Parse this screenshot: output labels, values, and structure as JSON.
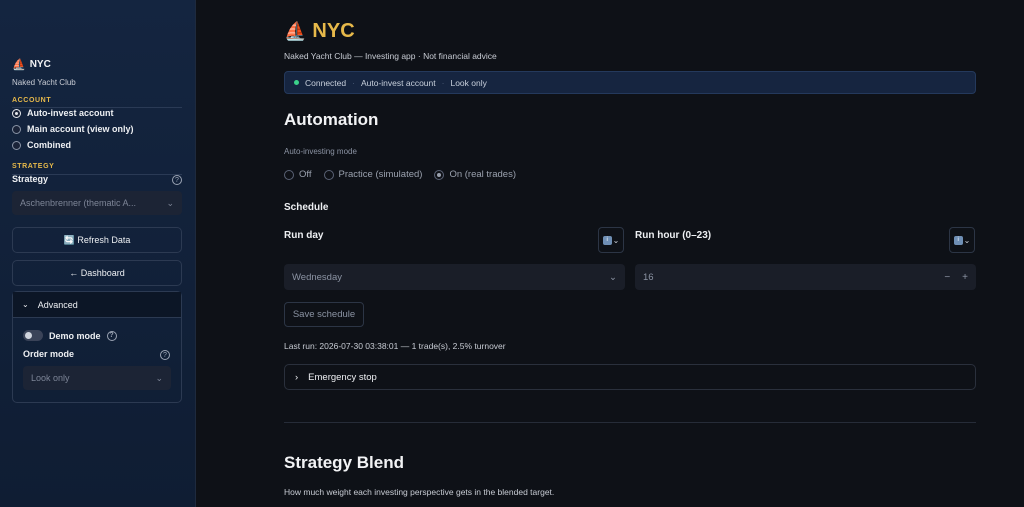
{
  "sidebar": {
    "brand_icon": "⛵",
    "brand": "NYC",
    "club": "Naked Yacht Club",
    "account_label": "ACCOUNT",
    "accounts": [
      {
        "label": "Auto-invest account",
        "selected": true
      },
      {
        "label": "Main account (view only)",
        "selected": false
      },
      {
        "label": "Combined",
        "selected": false
      }
    ],
    "strategy_section": "STRATEGY",
    "strategy_label": "Strategy",
    "strategy_value": "Aschenbrenner (thematic A...",
    "refresh_label": "🔄 Refresh Data",
    "dashboard_label": "← Dashboard",
    "advanced": {
      "title": "Advanced",
      "demo_label": "Demo mode",
      "order_label": "Order mode",
      "order_value": "Look only"
    }
  },
  "main": {
    "brand_icon": "⛵",
    "title": "NYC",
    "subtitle": "Naked Yacht Club — Investing app · Not financial advice",
    "status": {
      "connected": "Connected",
      "account": "Auto-invest account",
      "mode": "Look only",
      "dot_color": "#3bd28a"
    },
    "automation_title": "Automation",
    "mode_label": "Auto-investing mode",
    "modes": [
      {
        "label": "Off",
        "selected": false
      },
      {
        "label": "Practice (simulated)",
        "selected": false
      },
      {
        "label": "On (real trades)",
        "selected": true
      }
    ],
    "schedule_title": "Schedule",
    "run_day_label": "Run day",
    "run_day_value": "Wednesday",
    "run_hour_label": "Run hour (0–23)",
    "run_hour_value": "16",
    "save_label": "Save schedule",
    "last_run": "Last run: 2026-07-30 03:38:01 — 1 trade(s), 2.5% turnover",
    "emergency_label": "Emergency stop",
    "blend_title": "Strategy Blend",
    "blend_sub": "How much weight each investing perspective gets in the blended target."
  },
  "colors": {
    "accent": "#e7b94a",
    "background": "#0e1117",
    "sidebar": "#142540"
  }
}
